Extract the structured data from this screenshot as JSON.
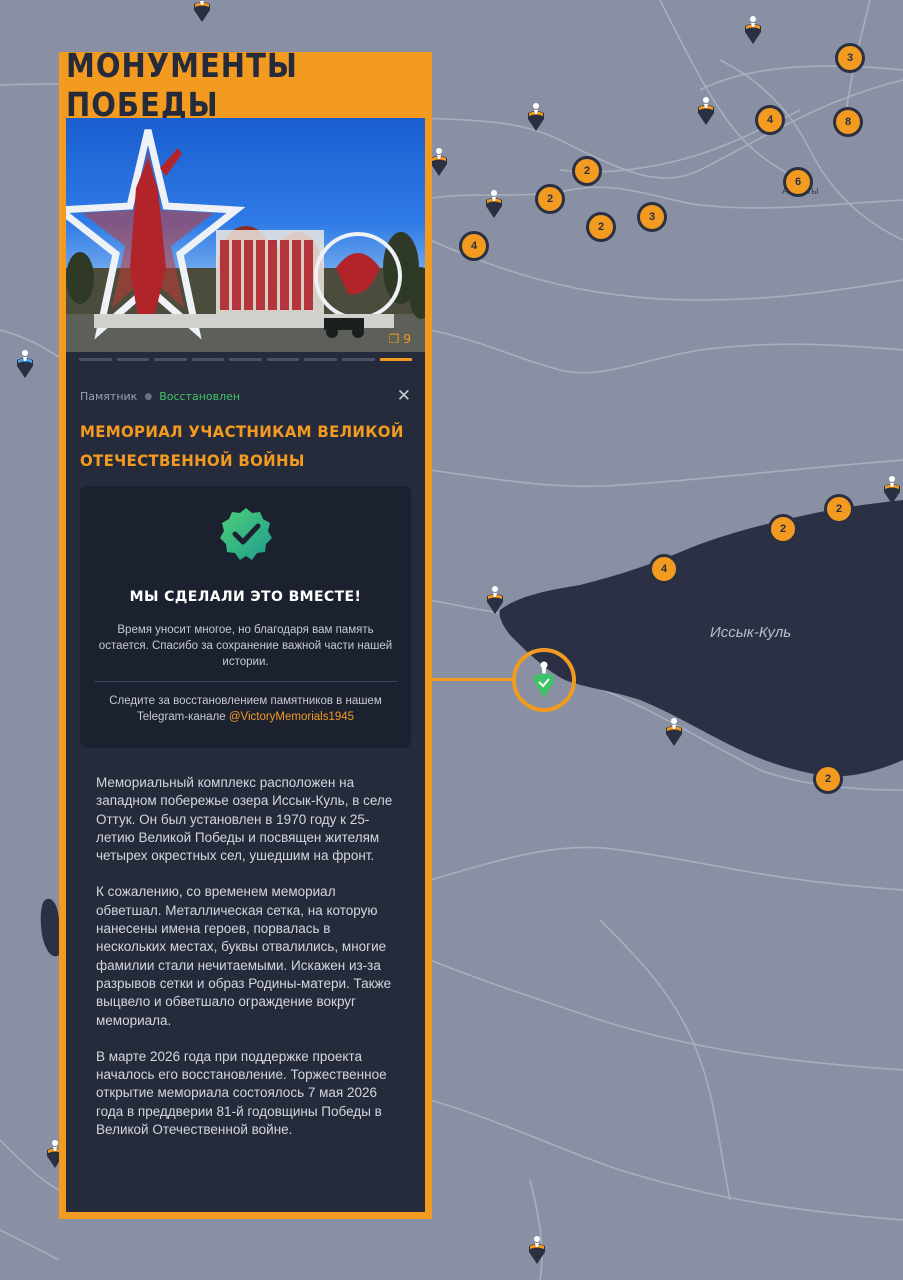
{
  "map": {
    "lake_label": "Иссык-Куль",
    "city_label": "Алматы",
    "clusters": [
      {
        "count": "3"
      },
      {
        "count": "4"
      },
      {
        "count": "8"
      },
      {
        "count": "6"
      },
      {
        "count": "2"
      },
      {
        "count": "2"
      },
      {
        "count": "2"
      },
      {
        "count": "3"
      },
      {
        "count": "4"
      },
      {
        "count": "2"
      },
      {
        "count": "2"
      },
      {
        "count": "4"
      },
      {
        "count": "2"
      }
    ],
    "colors": {
      "background": "#8a90a4",
      "lake": "#2b3044",
      "road": "#a9aebd",
      "accent": "#f39a21",
      "restored": "#3fc36a"
    }
  },
  "panel": {
    "header_title": "МОНУМЕНТЫ ПОБЕДЫ",
    "photo": {
      "count": "9",
      "icon": "gallery-icon",
      "slides_total": 9,
      "active_slide": 9
    },
    "meta": {
      "type": "Памятник",
      "status": "Восстановлен"
    },
    "title": "МЕМОРИАЛ УЧАСТНИКАМ ВЕЛИКОЙ ОТЕЧЕСТВЕННОЙ ВОЙНЫ",
    "card": {
      "title": "МЫ СДЕЛАЛИ ЭТО ВМЕСТЕ!",
      "text": "Время уносит многое, но благодаря вам память остается. Спасибо за сохранение важной части нашей истории.",
      "telegram_prefix": "Следите за восстановлением памятников в нашем Telegram-канале ",
      "telegram_link": "@VictoryMemorials1945"
    },
    "description": [
      "Мемориальный комплекс расположен на западном побережье озера Иссык-Куль, в селе Оттук. Он был установлен в 1970 году к 25-летию Великой Победы и посвящен жителям четырех окрестных сел, ушедшим на фронт.",
      "К сожалению, со временем мемориал обветшал. Металлическая сетка, на которую нанесены имена героев, порвалась в нескольких местах, буквы отвалились, многие фамилии стали нечитаемыми. Искажен из-за разрывов сетки и образ Родины-матери. Также выцвело и обветшало ограждение вокруг мемориала.",
      "В марте 2026 года при поддержке проекта началось его восстановление. Торжественное открытие мемориала состоялось 7 мая 2026 года в преддверии 81-й годовщины Победы в Великой Отечественной войне."
    ]
  }
}
